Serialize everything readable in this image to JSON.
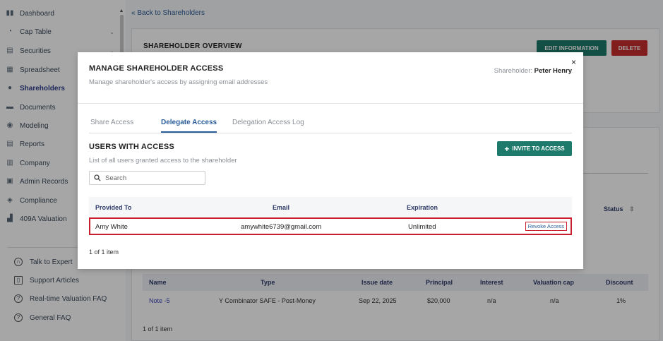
{
  "sidebar": {
    "items": [
      {
        "label": "Dashboard",
        "icon": "dashboard-icon",
        "glyph": "▮▮"
      },
      {
        "label": "Cap Table",
        "icon": "pie-chart-icon",
        "glyph": "◔",
        "chevron": "⌄"
      },
      {
        "label": "Securities",
        "icon": "document-icon",
        "glyph": "▤",
        "chevron": "⌄"
      },
      {
        "label": "Spreadsheet",
        "icon": "spreadsheet-icon",
        "glyph": "▦"
      },
      {
        "label": "Shareholders",
        "icon": "user-icon",
        "glyph": "●"
      },
      {
        "label": "Documents",
        "icon": "folder-icon",
        "glyph": "▬"
      },
      {
        "label": "Modeling",
        "icon": "lightbulb-icon",
        "glyph": "◉"
      },
      {
        "label": "Reports",
        "icon": "report-icon",
        "glyph": "▤"
      },
      {
        "label": "Company",
        "icon": "company-icon",
        "glyph": "▥"
      },
      {
        "label": "Admin Records",
        "icon": "admin-icon",
        "glyph": "▣"
      },
      {
        "label": "Compliance",
        "icon": "shield-icon",
        "glyph": "◈"
      },
      {
        "label": "409A Valuation",
        "icon": "chart-icon",
        "glyph": "▟"
      }
    ],
    "active_index": 4,
    "bottom": [
      {
        "label": "Talk to Expert",
        "icon": "headset-icon",
        "glyph": "∩"
      },
      {
        "label": "Support Articles",
        "icon": "book-icon",
        "glyph": "▯"
      },
      {
        "label": "Real-time Valuation FAQ",
        "icon": "question-icon",
        "glyph": "?"
      },
      {
        "label": "General FAQ",
        "icon": "question-icon",
        "glyph": "?"
      }
    ]
  },
  "background": {
    "back_link": "Back to Shareholders",
    "back_glyph": "«",
    "overview_title": "SHAREHOLDER OVERVIEW",
    "edit_button": "EDIT INFORMATION",
    "delete_button": "DELETE",
    "status_header": "Status",
    "status_sort_glyph": "⇕",
    "notes_table": {
      "columns": [
        "Name",
        "Type",
        "Issue date",
        "Principal",
        "Interest",
        "Valuation cap",
        "Discount"
      ],
      "row": [
        "Note -5",
        "Y Combinator SAFE - Post-Money",
        "Sep 22, 2025",
        "$20,000",
        "n/a",
        "n/a",
        "1%"
      ]
    },
    "footer": "1 of 1 item"
  },
  "modal": {
    "title": "MANAGE SHAREHOLDER ACCESS",
    "subtitle": "Manage shareholder's access by assigning email addresses",
    "holder_label": "Shareholder:",
    "holder_name": "Peter Henry",
    "close_glyph": "×",
    "tabs": [
      "Share Access",
      "Delegate Access",
      "Delegation Access Log"
    ],
    "active_tab": 1,
    "users_title": "USERS WITH ACCESS",
    "users_subtitle": "List of all users granted access to the shareholder",
    "invite_button": "INVITE TO ACCESS",
    "invite_glyph": "+",
    "search_placeholder": "Search",
    "table": {
      "columns": [
        "Provided To",
        "Email",
        "Expiration"
      ],
      "rows": [
        {
          "provided_to": "Amy White",
          "email": "amywhite6739@gmail.com",
          "expiration": "Unlimited",
          "action": "Revoke Access"
        }
      ]
    },
    "footer": "1 of 1 item"
  },
  "colors": {
    "accent_teal": "#1e7a6a",
    "danger_red": "#c62d2d",
    "link_blue": "#2b5d9b",
    "highlight_red": "#c8202f"
  }
}
